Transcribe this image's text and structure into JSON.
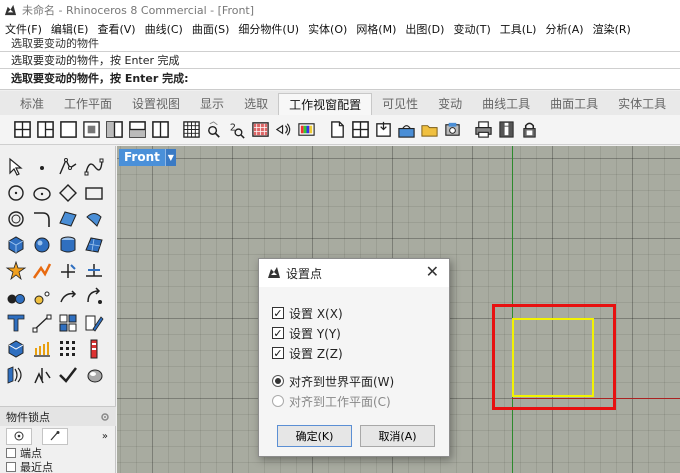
{
  "window": {
    "title": "未命名 - Rhinoceros 8 Commercial - [Front]"
  },
  "menu": [
    "文件(F)",
    "编辑(E)",
    "查看(V)",
    "曲线(C)",
    "曲面(S)",
    "细分物件(U)",
    "实体(O)",
    "网格(M)",
    "出图(D)",
    "变动(T)",
    "工具(L)",
    "分析(A)",
    "渲染(R)"
  ],
  "command": {
    "history_1": "选取要变动的物件",
    "history_2": "选取要变动的物件，按 Enter 完成",
    "prompt": "选取要变动的物件，按 Enter 完成:"
  },
  "tabs": [
    "标准",
    "工作平面",
    "设置视图",
    "显示",
    "选取",
    "工作视窗配置",
    "可见性",
    "变动",
    "曲线工具",
    "曲面工具",
    "实体工具"
  ],
  "active_tab": "工作视窗配置",
  "viewport": {
    "name": "Front"
  },
  "osnap": {
    "title": "物件锁点",
    "items": [
      "端点",
      "最近点"
    ]
  },
  "dialog": {
    "title": "设置点",
    "checks": [
      {
        "label": "设置 X(X)",
        "checked": true
      },
      {
        "label": "设置 Y(Y)",
        "checked": true
      },
      {
        "label": "设置 Z(Z)",
        "checked": true
      }
    ],
    "radios": [
      {
        "label": "对齐到世界平面(W)",
        "selected": true
      },
      {
        "label": "对齐到工作平面(C)",
        "selected": false
      }
    ],
    "ok": "确定(K)",
    "cancel": "取消(A)"
  },
  "colors": {
    "viewport_bg": "#a8aba0",
    "x_axis": "#aa2222",
    "y_axis": "#2d8a2d",
    "highlight": "#e81010",
    "selected_curve": "#f2f200",
    "viewport_label": "#4a90d9"
  }
}
